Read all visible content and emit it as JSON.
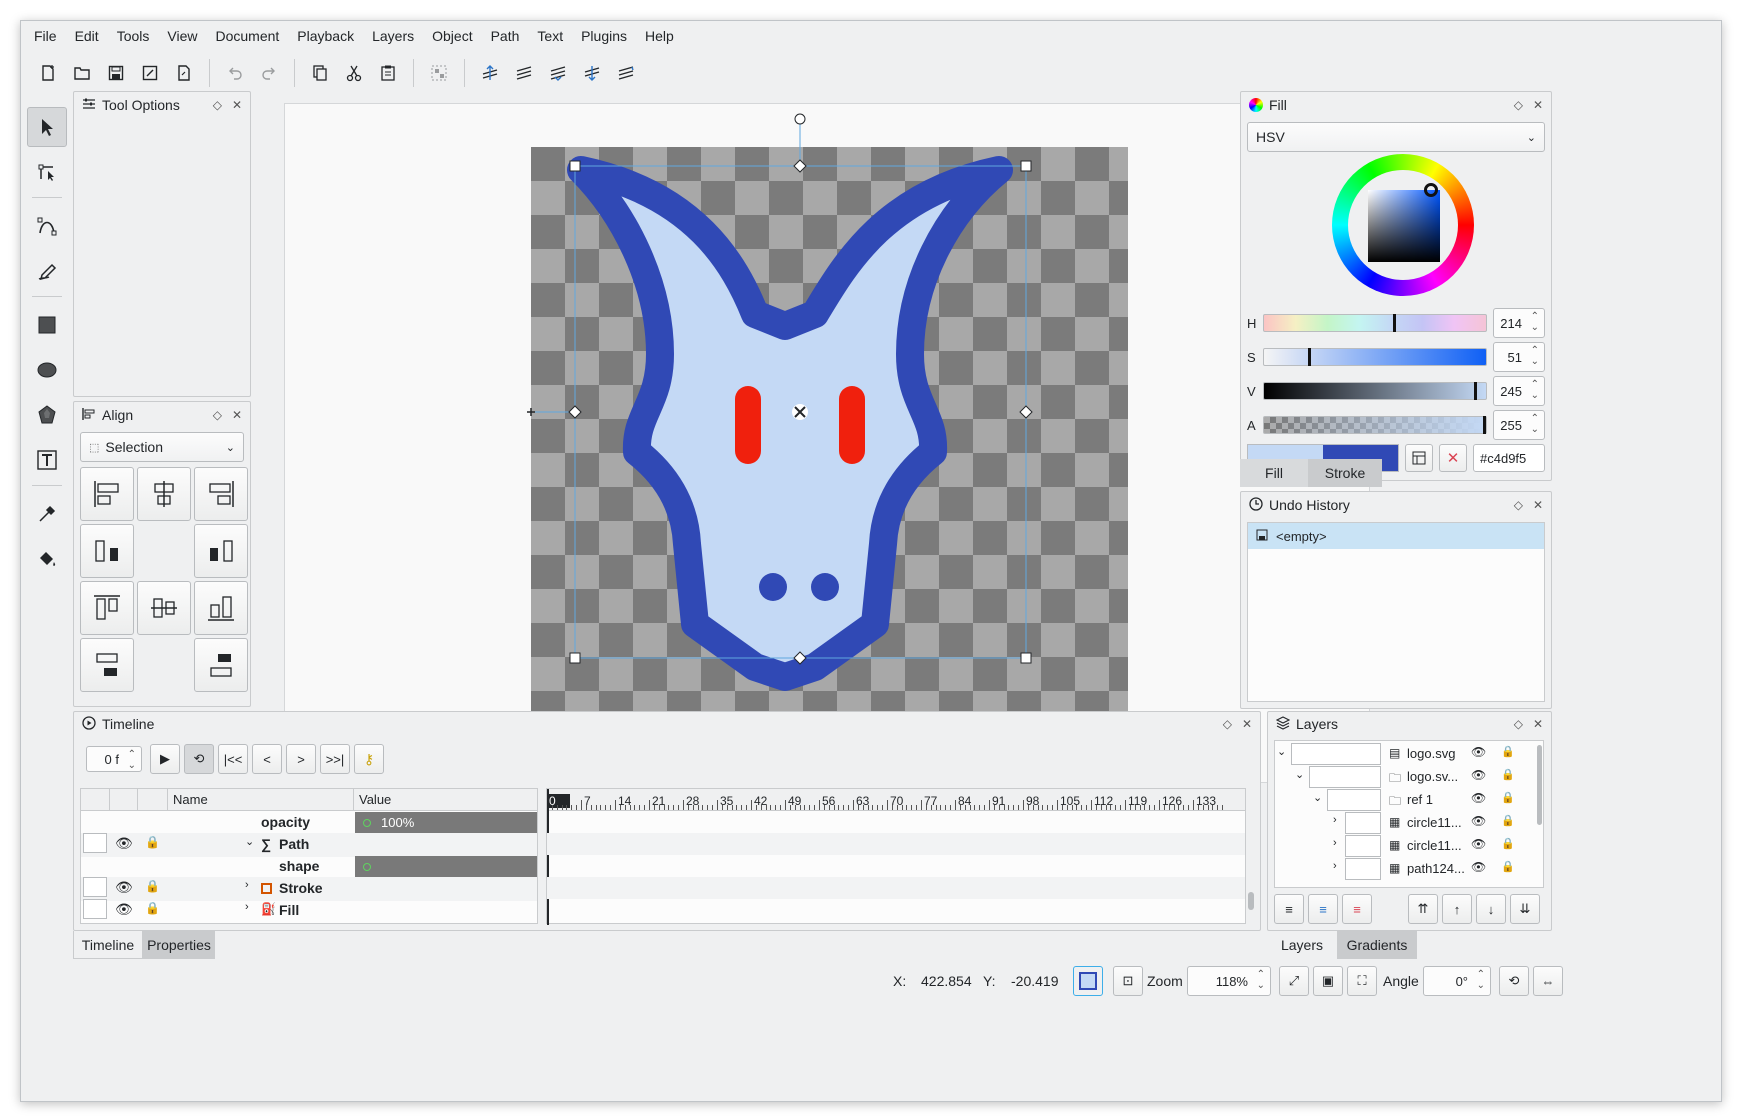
{
  "menu": [
    "File",
    "Edit",
    "Tools",
    "View",
    "Document",
    "Playback",
    "Layers",
    "Object",
    "Path",
    "Text",
    "Plugins",
    "Help"
  ],
  "toolbar_icons": [
    "new-file-icon",
    "open-file-icon",
    "save-icon",
    "save-as-icon",
    "save-copy-icon",
    "undo-icon",
    "redo-icon",
    "copy-icon",
    "cut-icon",
    "paste-icon",
    "group-icon",
    "raise-to-top-icon",
    "raise-icon",
    "lower-icon",
    "lower-to-bottom-icon",
    "flip-icon"
  ],
  "tools": [
    "select-tool",
    "edit-nodes-tool",
    "draw-bezier-tool",
    "freehand-tool",
    "rectangle-tool",
    "ellipse-tool",
    "star-tool",
    "text-tool",
    "color-picker-tool",
    "fill-tool"
  ],
  "tool_options": {
    "title": "Tool Options"
  },
  "align": {
    "title": "Align",
    "relative_to": "Selection"
  },
  "fill_panel": {
    "title": "Fill",
    "model": "HSV",
    "h": {
      "label": "H",
      "value": "214",
      "level": 0.59
    },
    "s": {
      "label": "S",
      "value": "51",
      "level": 0.2
    },
    "v": {
      "label": "V",
      "value": "245",
      "level": 0.96
    },
    "a": {
      "label": "A",
      "value": "255",
      "level": 1.0
    },
    "hex": "#c4d9f5",
    "fill_color": "#c4d9f5",
    "stroke_color": "#3049b5",
    "tabs": [
      "Fill",
      "Stroke"
    ]
  },
  "undo_history": {
    "title": "Undo History",
    "items": [
      "<empty>"
    ]
  },
  "timeline": {
    "title": "Timeline",
    "frame": "0 f",
    "columns": {
      "name": "Name",
      "value": "Value"
    },
    "ruler": [
      "0",
      "7",
      "14",
      "21",
      "28",
      "35",
      "42",
      "49",
      "56",
      "63",
      "70",
      "77",
      "84",
      "91",
      "98",
      "105",
      "112",
      "119",
      "126",
      "133"
    ],
    "rows": [
      {
        "name": "opacity",
        "value": "100%"
      },
      {
        "name": "Path",
        "value": ""
      },
      {
        "name": "shape",
        "value": ""
      },
      {
        "name": "Stroke",
        "value": ""
      },
      {
        "name": "Fill",
        "value": ""
      }
    ],
    "bottom_tabs": [
      "Timeline",
      "Properties"
    ]
  },
  "layers": {
    "title": "Layers",
    "items": [
      "logo.svg",
      "logo.sv...",
      "ref 1",
      "circle11...",
      "circle11...",
      "path124..."
    ],
    "bottom_tabs": [
      "Layers",
      "Gradients"
    ]
  },
  "status": {
    "x_label": "X:",
    "x": "422.854",
    "y_label": "Y:",
    "y": "-20.419",
    "zoom_label": "Zoom",
    "zoom": "118%",
    "angle_label": "Angle",
    "angle": "0°"
  },
  "colors": {
    "accent": "#3daee9",
    "selection_bg": "#c9e3f5"
  }
}
